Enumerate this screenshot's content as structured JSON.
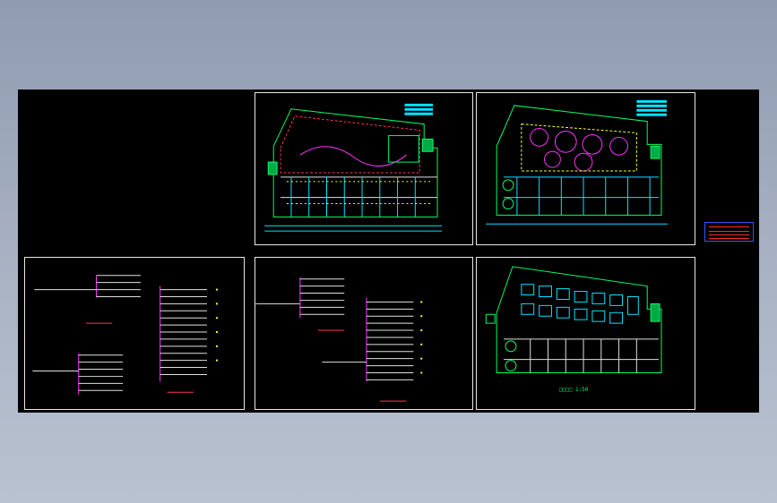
{
  "viewer": {
    "background_top": "#8f9bb0",
    "background_bottom": "#b9c2d0",
    "canvas_color": "#000000"
  },
  "colors": {
    "sheet_border": "#e8e8e8",
    "wall": "#00ff66",
    "wire": "#ff3355",
    "dim": "#00e5ff",
    "magenta": "#ff33ff",
    "yellow": "#ffff33",
    "white": "#e0e0e0",
    "stamp_border": "#3355ff",
    "stamp_text": "#ff2a2a"
  },
  "sheets": [
    {
      "id": "floor-plan-lighting",
      "kind": "floor-plan"
    },
    {
      "id": "floor-plan-ceiling",
      "kind": "floor-plan"
    },
    {
      "id": "system-diagram-a",
      "kind": "riser"
    },
    {
      "id": "system-diagram-b",
      "kind": "riser"
    },
    {
      "id": "floor-plan-seating",
      "kind": "floor-plan",
      "caption": "□□□□ 1:50"
    }
  ]
}
